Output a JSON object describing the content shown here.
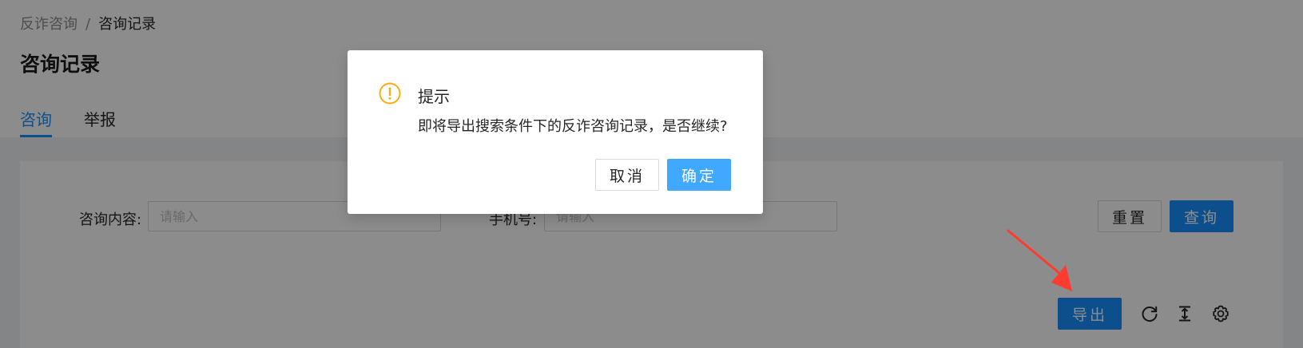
{
  "breadcrumb": {
    "parent": "反诈咨询",
    "separator": "/",
    "current": "咨询记录"
  },
  "page": {
    "title": "咨询记录"
  },
  "tabs": [
    {
      "label": "咨询",
      "active": true
    },
    {
      "label": "举报",
      "active": false
    }
  ],
  "search_form": {
    "content_label": "咨询内容:",
    "content_placeholder": "请输入",
    "content_value": "",
    "phone_label": "手机号:",
    "phone_placeholder": "请输入",
    "phone_value": "",
    "reset_label": "重置",
    "query_label": "查询"
  },
  "toolbar": {
    "export_label": "导出",
    "icons": [
      "reload-icon",
      "column-height-icon",
      "setting-icon"
    ]
  },
  "modal": {
    "icon": "exclamation-circle-icon",
    "title": "提示",
    "content": "即将导出搜索条件下的反诈咨询记录，是否继续?",
    "cancel_label": "取消",
    "ok_label": "确定"
  },
  "colors": {
    "primary": "#1890ff",
    "warning": "#faad14",
    "annotation_arrow": "#ff3b30",
    "mask": "rgba(0,0,0,0.45)"
  }
}
